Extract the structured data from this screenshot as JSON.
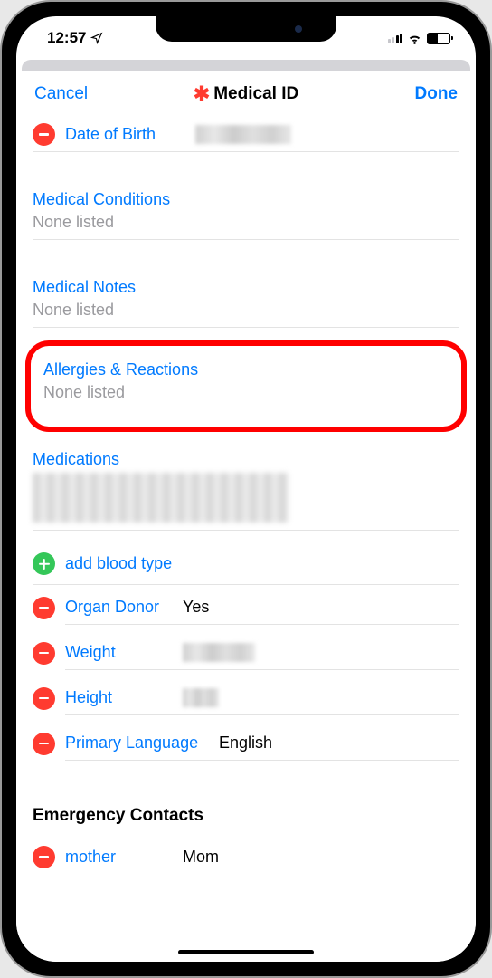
{
  "status": {
    "time": "12:57",
    "location_icon": "location-arrow"
  },
  "header": {
    "cancel": "Cancel",
    "title": "Medical ID",
    "done": "Done"
  },
  "fields": {
    "dob": {
      "label": "Date of Birth",
      "value": "Mar 23, 1984"
    },
    "conditions": {
      "label": "Medical Conditions",
      "placeholder": "None listed"
    },
    "notes": {
      "label": "Medical Notes",
      "placeholder": "None listed"
    },
    "allergies": {
      "label": "Allergies & Reactions",
      "placeholder": "None listed"
    },
    "medications": {
      "label": "Medications"
    },
    "blood_type": {
      "label": "add blood type"
    },
    "organ_donor": {
      "label": "Organ Donor",
      "value": "Yes"
    },
    "weight": {
      "label": "Weight",
      "value": "150 lb"
    },
    "height": {
      "label": "Height",
      "value": "5 7"
    },
    "language": {
      "label": "Primary Language",
      "value": "English"
    }
  },
  "emergency": {
    "header": "Emergency Contacts",
    "contacts": [
      {
        "relation": "mother",
        "name": "Mom"
      }
    ]
  }
}
